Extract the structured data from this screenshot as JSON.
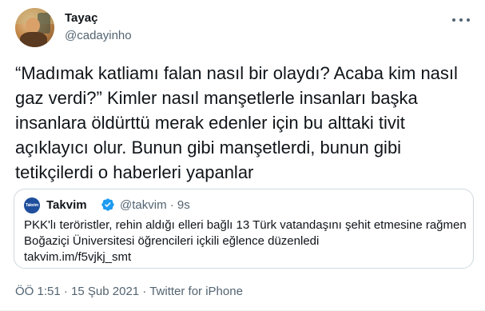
{
  "author": {
    "name": "Tayaç",
    "handle": "@cadayinho"
  },
  "tweet_text": "“Madımak katliamı falan nasıl bir olaydı? Acaba kim nasıl\ngaz verdi?” Kimler nasıl manşetlerle insanları başka\ninsanlara öldürttü merak edenler için bu alttaki tivit\naçıklayıcı olur. Bunun gibi manşetlerdi, bunun gibi\ntetikçilerdi o haberleri yapanlar",
  "quoted": {
    "avatar_text": "Takvim",
    "name": "Takvim",
    "handle_time": "@takvim · 9s",
    "text": "PKK'lı teröristler, rehin aldığı elleri bağlı 13 Türk vatandaşını şehit etmesine rağmen Boğaziçi Üniversitesi öğrencileri içkili eğlence düzenledi\ntakvim.im/f5vjkj_smt"
  },
  "meta": {
    "time": "ÖÖ 1:51",
    "sep1": " · ",
    "date": "15 Şub 2021",
    "sep2": " · ",
    "source": "Twitter for iPhone"
  },
  "colors": {
    "verified": "#1d9bf0",
    "secondary_text": "#536471",
    "border": "#cfd9de"
  },
  "icons": [
    "more-icon",
    "verified-badge-icon"
  ]
}
